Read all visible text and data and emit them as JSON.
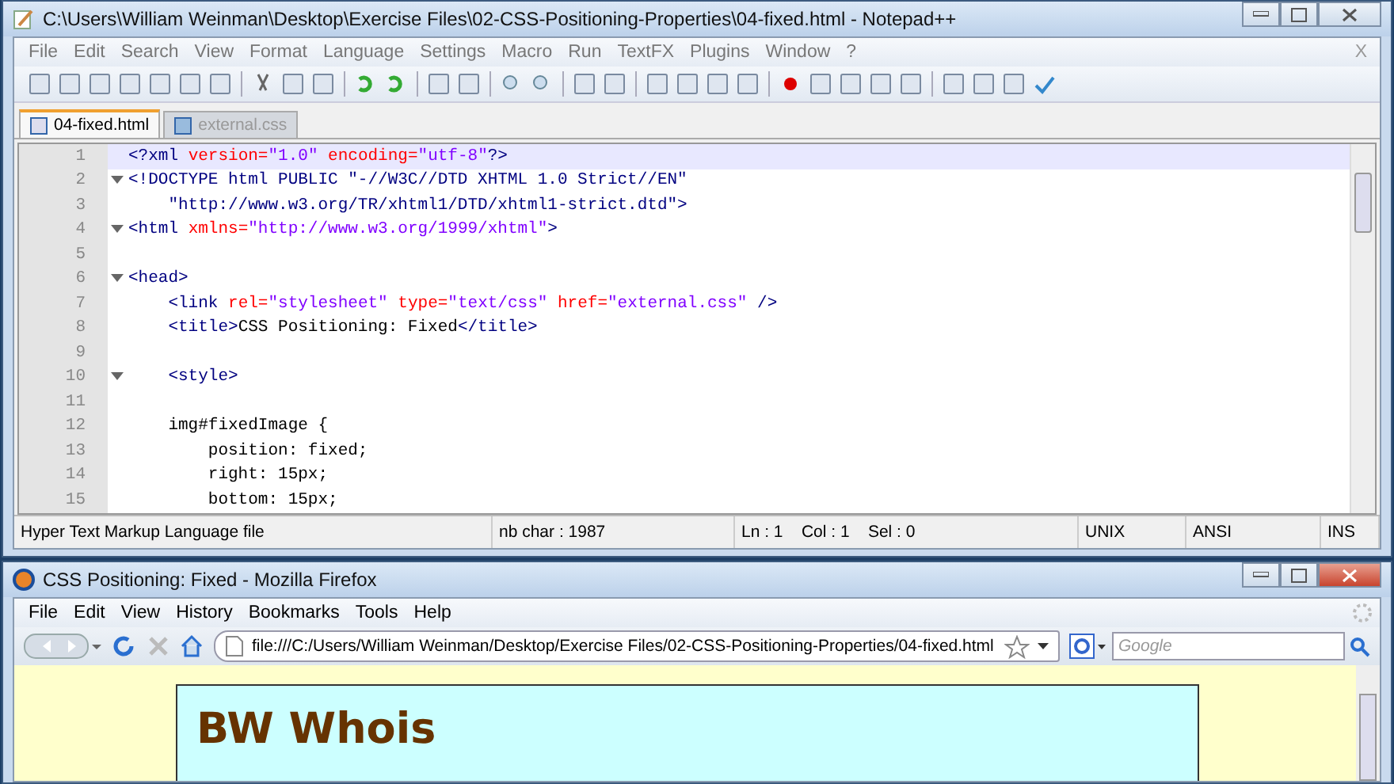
{
  "editor_window": {
    "title": "C:\\Users\\William Weinman\\Desktop\\Exercise Files\\02-CSS-Positioning-Properties\\04-fixed.html - Notepad++",
    "menu": [
      "File",
      "Edit",
      "Search",
      "View",
      "Format",
      "Language",
      "Settings",
      "Macro",
      "Run",
      "TextFX",
      "Plugins",
      "Window",
      "?"
    ],
    "menu_close": "X",
    "tabs": [
      {
        "label": "04-fixed.html",
        "selected": true
      },
      {
        "label": "external.css",
        "selected": false
      }
    ],
    "lines": [
      {
        "number": "1",
        "fold": false,
        "current": true,
        "tokens": [
          {
            "kind": "tag",
            "text": "<?xml "
          },
          {
            "kind": "attr",
            "text": "version="
          },
          {
            "kind": "value",
            "text": "\"1.0\""
          },
          {
            "kind": "attr",
            "text": " encoding="
          },
          {
            "kind": "value",
            "text": "\"utf-8\""
          },
          {
            "kind": "tag",
            "text": "?>"
          }
        ]
      },
      {
        "number": "2",
        "fold": true,
        "current": false,
        "tokens": [
          {
            "kind": "tag",
            "text": "<!DOCTYPE html PUBLIC \"-//W3C//DTD XHTML 1.0 Strict//EN\""
          }
        ]
      },
      {
        "number": "3",
        "fold": false,
        "current": false,
        "tokens": [
          {
            "kind": "tag",
            "text": "    \"http://www.w3.org/TR/xhtml1/DTD/xhtml1-strict.dtd\">"
          }
        ]
      },
      {
        "number": "4",
        "fold": true,
        "current": false,
        "tokens": [
          {
            "kind": "tag",
            "text": "<html "
          },
          {
            "kind": "attr",
            "text": "xmlns="
          },
          {
            "kind": "value",
            "text": "\"http://www.w3.org/1999/xhtml\""
          },
          {
            "kind": "tag",
            "text": ">"
          }
        ]
      },
      {
        "number": "5",
        "fold": false,
        "current": false
      },
      {
        "number": "6",
        "fold": true,
        "current": false,
        "tokens": [
          {
            "kind": "tag",
            "text": "<head>"
          }
        ]
      },
      {
        "number": "7",
        "fold": false,
        "current": false,
        "tokens": [
          {
            "kind": "tag",
            "text": "    <link "
          },
          {
            "kind": "attr",
            "text": "rel="
          },
          {
            "kind": "value",
            "text": "\"stylesheet\""
          },
          {
            "kind": "attr",
            "text": " type="
          },
          {
            "kind": "value",
            "text": "\"text/css\""
          },
          {
            "kind": "attr",
            "text": " href="
          },
          {
            "kind": "value",
            "text": "\"external.css\""
          },
          {
            "kind": "tag",
            "text": " />"
          }
        ]
      },
      {
        "number": "8",
        "fold": false,
        "current": false,
        "tokens": [
          {
            "kind": "tag",
            "text": "    <title>"
          },
          {
            "kind": "text",
            "text": "CSS Positioning: Fixed"
          },
          {
            "kind": "tag",
            "text": "</title>"
          }
        ]
      },
      {
        "number": "9",
        "fold": false,
        "current": false
      },
      {
        "number": "10",
        "fold": true,
        "current": false,
        "tokens": [
          {
            "kind": "tag",
            "text": "    <style>"
          }
        ]
      },
      {
        "number": "11",
        "fold": false,
        "current": false
      },
      {
        "number": "12",
        "fold": false,
        "current": false,
        "tokens": [
          {
            "kind": "text",
            "text": "    img#fixedImage {"
          }
        ]
      },
      {
        "number": "13",
        "fold": false,
        "current": false,
        "tokens": [
          {
            "kind": "text",
            "text": "        position: fixed;"
          }
        ]
      },
      {
        "number": "14",
        "fold": false,
        "current": false,
        "tokens": [
          {
            "kind": "text",
            "text": "        right: 15px;"
          }
        ]
      },
      {
        "number": "15",
        "fold": false,
        "current": false,
        "tokens": [
          {
            "kind": "text",
            "text": "        bottom: 15px;"
          }
        ]
      }
    ],
    "status_bar": [
      "Hyper Text Markup Language file",
      "nb char : 1987",
      "Ln : 1    Col : 1    Sel : 0",
      "UNIX",
      "ANSI",
      "INS"
    ]
  },
  "browser_window": {
    "title": "CSS Positioning: Fixed - Mozilla Firefox",
    "menu": [
      "File",
      "Edit",
      "View",
      "History",
      "Bookmarks",
      "Tools",
      "Help"
    ],
    "address": "file:///C:/Users/William Weinman/Desktop/Exercise Files/02-CSS-Positioning-Properties/04-fixed.html",
    "search": {
      "placeholder": "Google"
    },
    "page": {
      "heading": "BW Whois"
    }
  }
}
